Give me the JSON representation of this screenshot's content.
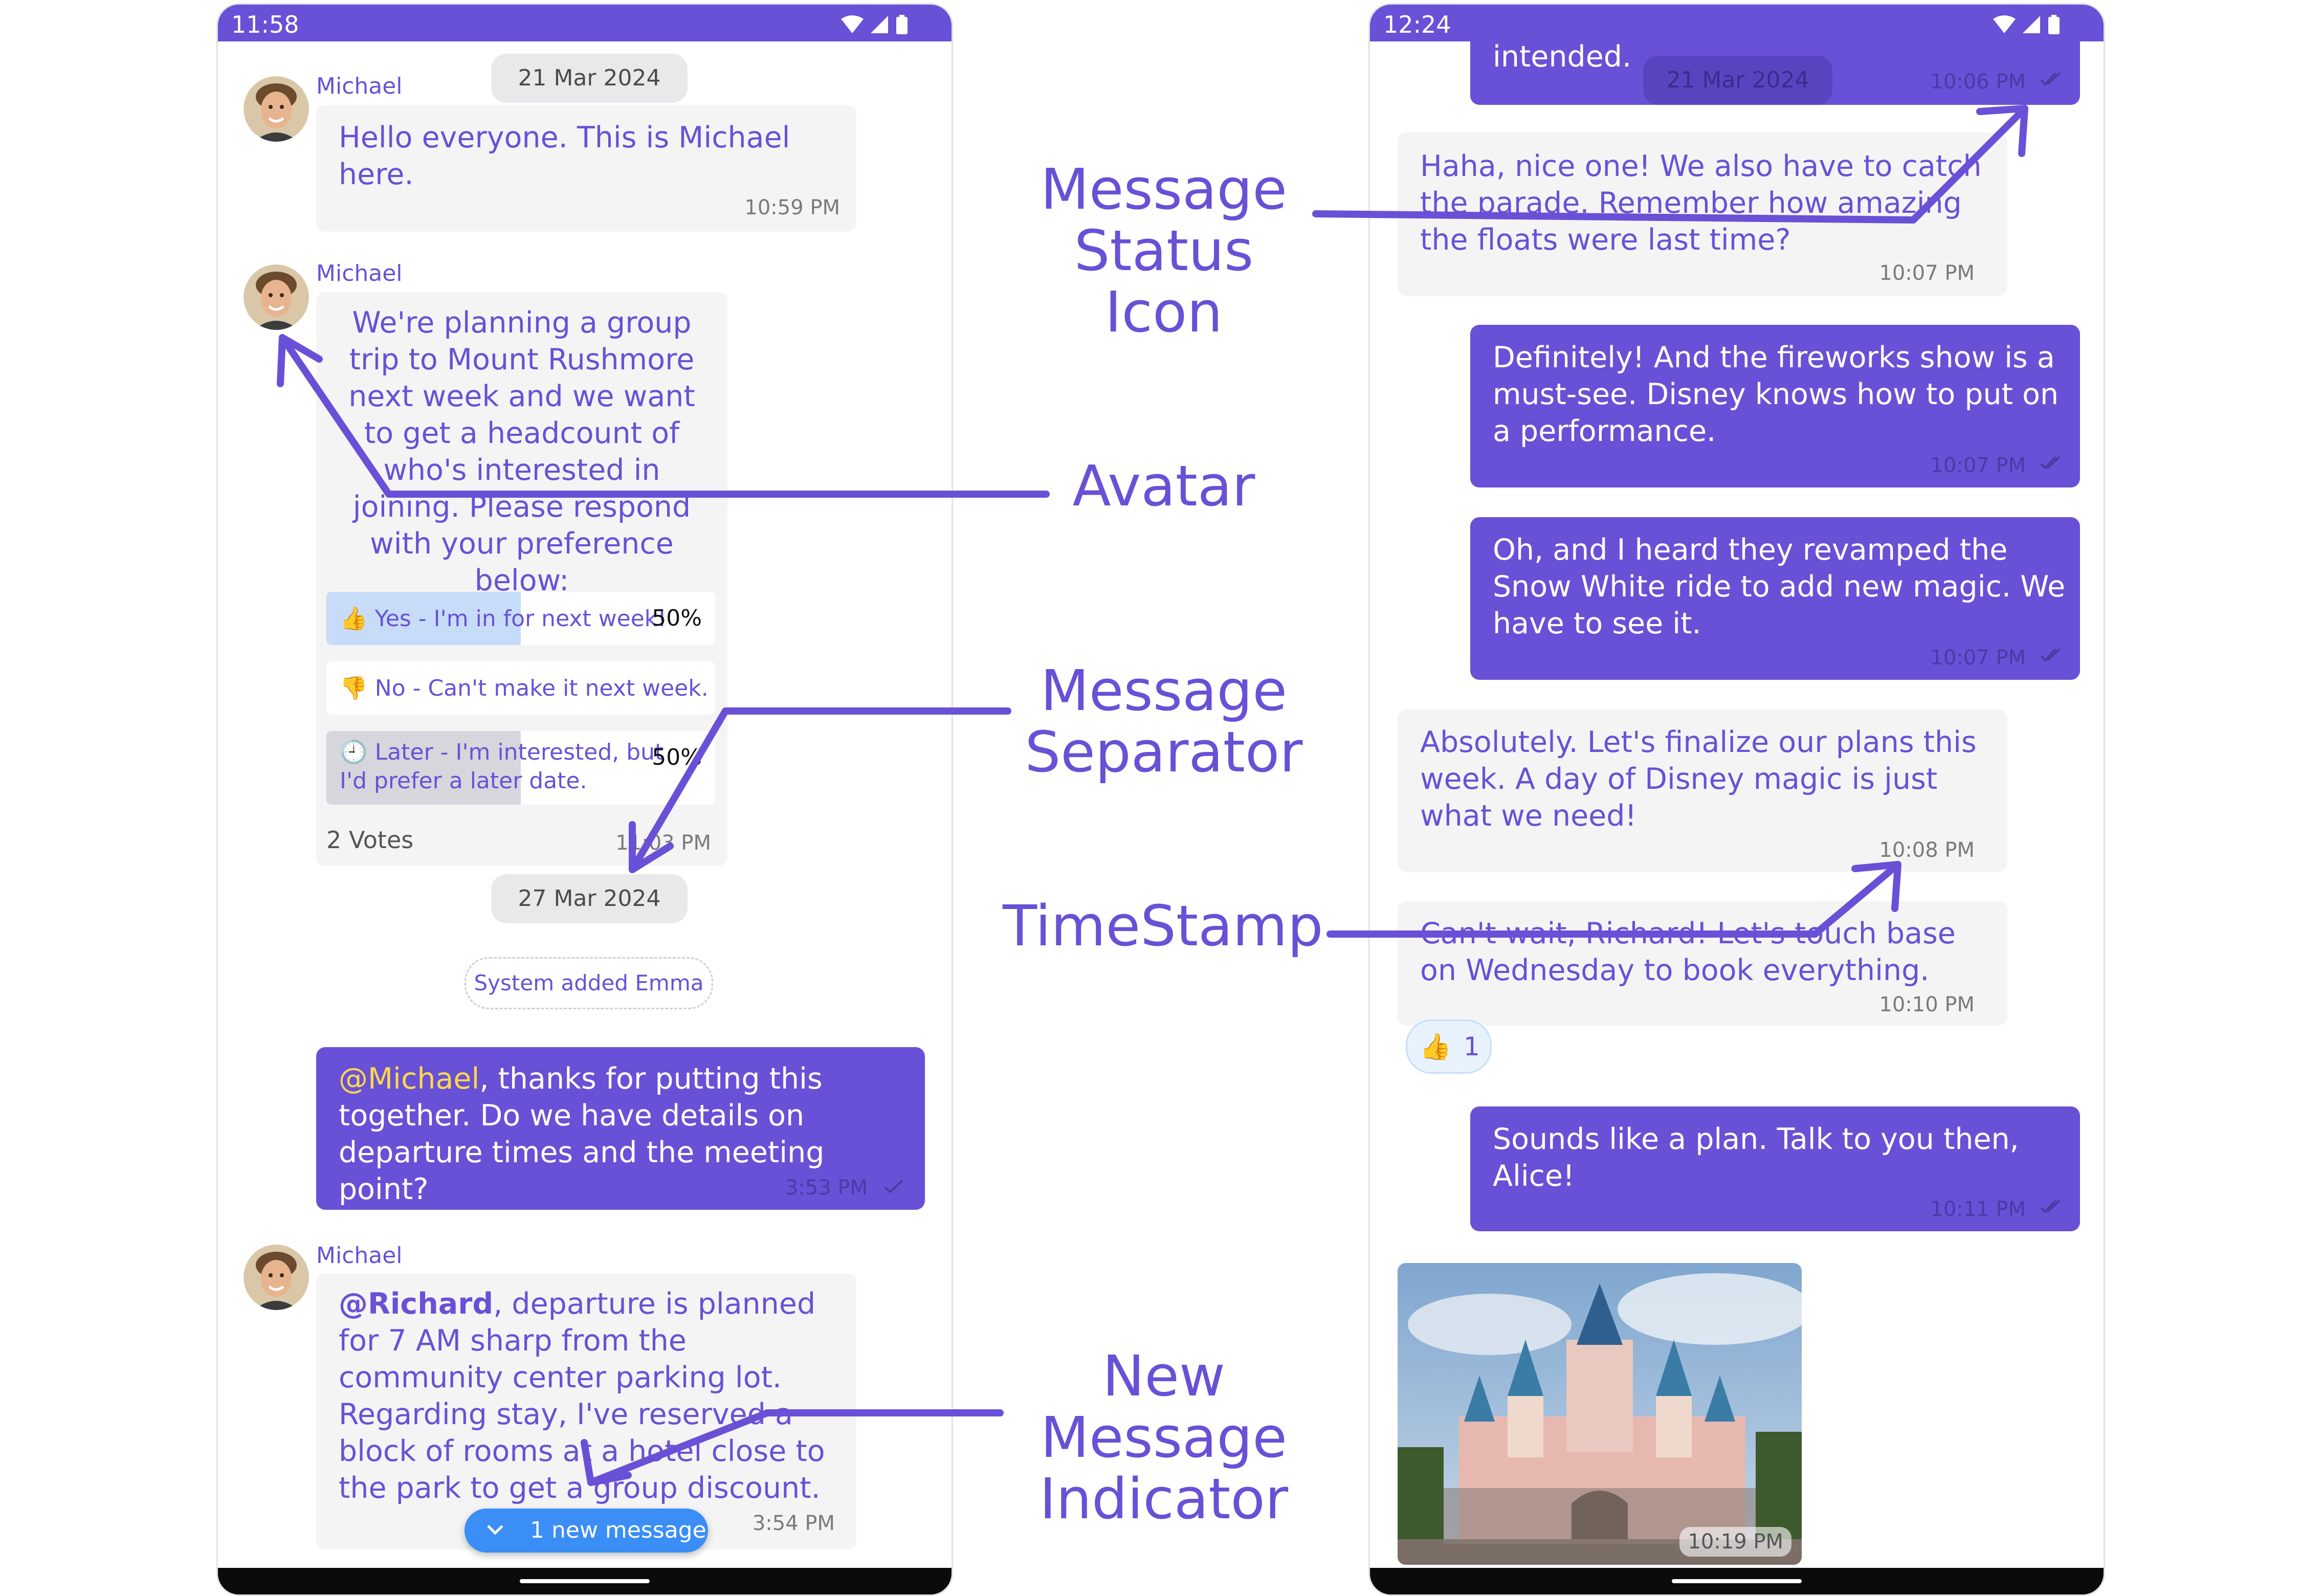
{
  "left_phone": {
    "status_time": "11:58",
    "date_top": "21 Mar 2024",
    "msg1": {
      "sender": "Michael",
      "text": "Hello everyone. This is Michael here.",
      "time": "10:59 PM"
    },
    "poll": {
      "sender": "Michael",
      "question": "We're planning a group trip to Mount Rushmore next week and we want to get a headcount of who's interested in joining. Please respond with your preference below:",
      "options": [
        {
          "emoji": "👍",
          "label": "Yes - I'm in for next week!",
          "percent": "50%",
          "fill": 0.5
        },
        {
          "emoji": "👎",
          "label": "No - Can't make it next week.",
          "percent": "",
          "fill": 0
        },
        {
          "emoji": "🕘",
          "label": "Later - I'm interested, but I'd prefer a later date.",
          "percent": "50%",
          "fill": 0.5
        }
      ],
      "votes": "2 Votes",
      "time": "11:03 PM"
    },
    "date_mid": "27 Mar 2024",
    "system_msg": "System added Emma",
    "msg_out": {
      "mention": "@Michael",
      "text": ", thanks for putting this together. Do we have details on departure times and the meeting point?",
      "time": "3:53 PM"
    },
    "msg_last": {
      "sender": "Michael",
      "mention": "@Richard",
      "text": ", departure is planned for 7 AM sharp from the community center parking lot. Regarding stay, I've reserved a block of rooms at a hotel close to the park to get a group discount.",
      "time": "3:54 PM"
    },
    "new_message": "1 new message"
  },
  "right_phone": {
    "status_time": "12:24",
    "top_partial": {
      "text": "intended.",
      "time": "10:06 PM"
    },
    "date_floating": "21 Mar 2024",
    "messages": [
      {
        "dir": "in",
        "text": "Haha, nice one! We also have to catch the parade. Remember how amazing the floats were last time?",
        "time": "10:07 PM"
      },
      {
        "dir": "out",
        "text": "Definitely! And the fireworks show is a must-see. Disney knows how to put on a performance.",
        "time": "10:07 PM"
      },
      {
        "dir": "out",
        "text": "Oh, and I heard they revamped the Snow White ride to add new magic. We have to see it.",
        "time": "10:07 PM"
      },
      {
        "dir": "in",
        "text": "Absolutely. Let's finalize our plans this week. A day of Disney magic is just what we need!",
        "time": "10:08 PM"
      },
      {
        "dir": "in",
        "text": "Can't wait, Richard! Let's touch base on Wednesday to book everything.",
        "time": "10:10 PM"
      },
      {
        "dir": "out",
        "text": "Sounds like a plan. Talk to you then, Alice!",
        "time": "10:11 PM"
      }
    ],
    "reaction": {
      "emoji": "👍",
      "count": "1"
    },
    "image_time": "10:19 PM"
  },
  "annotations": {
    "status_icon": "Message Status Icon",
    "avatar": "Avatar",
    "separator": "Message Separator",
    "timestamp": "TimeStamp",
    "new_indicator": "New Message Indicator"
  },
  "colors": {
    "primary": "#6851d6",
    "incoming_bg": "#f4f4f5",
    "mention": "#ffd84a",
    "indicator": "#3a8ef6"
  }
}
